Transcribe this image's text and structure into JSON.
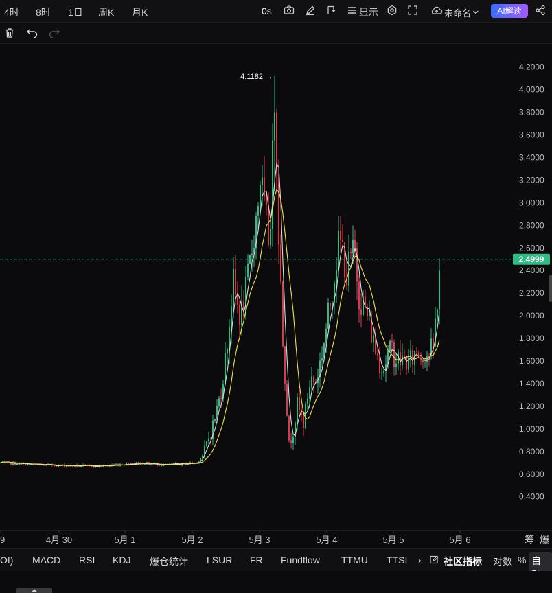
{
  "toolbar": {
    "timeframes": [
      "4时",
      "8时",
      "1日",
      "周K",
      "月K"
    ],
    "countdown": "0s",
    "display_label": "显示",
    "layout_name": "未命名",
    "ai_label": "AI解读"
  },
  "bottom_tabs": {
    "indicators": [
      "OI)",
      "MACD",
      "RSI",
      "KDJ",
      "爆仓统计",
      "LSUR",
      "FR",
      "Fundflow",
      "TTMU",
      "TTSI"
    ],
    "more": "›",
    "community": "社区指标",
    "log": "对数",
    "percent": "%",
    "auto": "自动"
  },
  "right_tabs": [
    "筹",
    "爆"
  ],
  "colors": {
    "up": "#2ebd85",
    "down": "#e0374a",
    "ma_fast": "#d9d9d9",
    "ma_slow": "#f0e14a",
    "price_badge": "#2ebd85"
  },
  "chart_data": {
    "type": "candlestick",
    "ylim": [
      0.3,
      4.35
    ],
    "y_ticks": [
      "0.4000",
      "0.6000",
      "0.8000",
      "1.0000",
      "1.2000",
      "1.4000",
      "1.6000",
      "1.8000",
      "2.0000",
      "2.2000",
      "2.4000",
      "2.6000",
      "2.8000",
      "3.0000",
      "3.2000",
      "3.4000",
      "3.6000",
      "3.8000",
      "4.0000",
      "4.2000"
    ],
    "x_ticks": [
      "9",
      "4月 30",
      "5月 1",
      "5月 2",
      "5月 3",
      "5月 4",
      "5月 5",
      "5月 6"
    ],
    "high_label": "4.1182",
    "last_price": "2.4999",
    "anchors": [
      [
        0,
        0.7
      ],
      [
        60,
        0.68
      ],
      [
        140,
        0.67
      ],
      [
        200,
        0.7
      ],
      [
        240,
        0.68
      ],
      [
        285,
        0.7
      ],
      [
        296,
        0.78
      ],
      [
        302,
        0.9
      ],
      [
        310,
        1.05
      ],
      [
        318,
        1.25
      ],
      [
        326,
        1.55
      ],
      [
        333,
        1.95
      ],
      [
        338,
        2.3
      ],
      [
        344,
        2.1
      ],
      [
        350,
        2.0
      ],
      [
        356,
        2.15
      ],
      [
        362,
        2.4
      ],
      [
        368,
        2.7
      ],
      [
        374,
        2.95
      ],
      [
        378,
        3.25
      ],
      [
        384,
        2.9
      ],
      [
        390,
        2.7
      ],
      [
        395,
        3.1
      ],
      [
        399,
        4.05
      ],
      [
        403,
        3.2
      ],
      [
        407,
        2.4
      ],
      [
        411,
        1.8
      ],
      [
        415,
        1.4
      ],
      [
        420,
        0.85
      ],
      [
        426,
        1.0
      ],
      [
        432,
        1.2
      ],
      [
        438,
        1.1
      ],
      [
        442,
        1.05
      ],
      [
        447,
        1.3
      ],
      [
        452,
        1.45
      ],
      [
        458,
        1.4
      ],
      [
        464,
        1.55
      ],
      [
        470,
        1.75
      ],
      [
        476,
        1.95
      ],
      [
        482,
        2.2
      ],
      [
        488,
        2.5
      ],
      [
        494,
        2.65
      ],
      [
        500,
        2.55
      ],
      [
        504,
        2.35
      ],
      [
        510,
        2.5
      ],
      [
        516,
        2.55
      ],
      [
        522,
        2.2
      ],
      [
        528,
        2.1
      ],
      [
        534,
        2.0
      ],
      [
        540,
        1.85
      ],
      [
        546,
        1.7
      ],
      [
        552,
        1.6
      ],
      [
        558,
        1.55
      ],
      [
        564,
        1.65
      ],
      [
        570,
        1.7
      ],
      [
        576,
        1.62
      ],
      [
        582,
        1.6
      ],
      [
        588,
        1.62
      ],
      [
        594,
        1.58
      ],
      [
        600,
        1.62
      ],
      [
        606,
        1.7
      ],
      [
        612,
        1.65
      ],
      [
        618,
        1.68
      ],
      [
        624,
        1.66
      ],
      [
        630,
        1.72
      ],
      [
        636,
        2.15
      ],
      [
        640,
        2.5
      ]
    ]
  }
}
